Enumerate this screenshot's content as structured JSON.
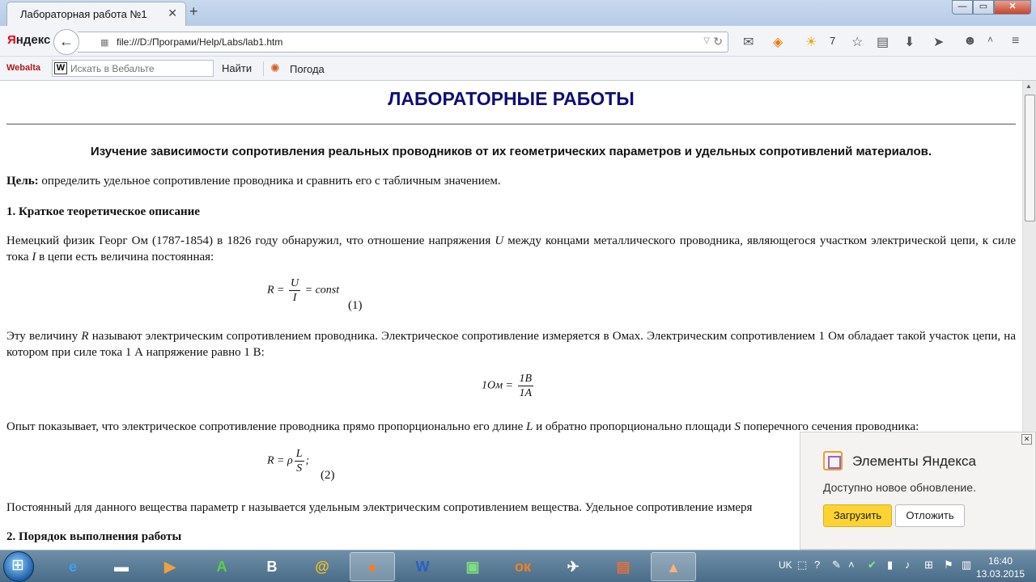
{
  "browser": {
    "tab_title": "Лабораторная работа №1",
    "tab_close": "✕",
    "new_tab": "+",
    "logo": "Яндекс",
    "url": "file:///D:/Програми/Help/Labs/lab1.htm",
    "weather_temp": "7",
    "window_buttons": {
      "minimize": "—",
      "maximize": "▭",
      "close": "✕"
    }
  },
  "bookmarks_bar": {
    "webalta_logo": "Webalta",
    "search_placeholder": "Искать в Вебальте",
    "search_box_letter": "W",
    "find_button": "Найти",
    "weather_link": "Погода"
  },
  "page": {
    "title": "ЛАБОРАТОРНЫЕ РАБОТЫ",
    "subtitle": "Изучение зависимости сопротивления реальных проводников от их геометрических параметров и удельных сопротивлений материалов.",
    "goal_label": "Цель:",
    "goal_text": " определить удельное сопротивление проводника и сравнить его с табличным значением.",
    "section1_heading": "1. Краткое теоретическое описание",
    "para1_a": "Немецкий физик Георг Ом (1787-1854) в 1826 году обнаружил, что отношение напряжения ",
    "para1_u": "U",
    "para1_b": " между концами металлического проводника, являющегося участком электрической цепи, к силе тока ",
    "para1_i": "I",
    "para1_c": " в цепи есть величина постоянная:",
    "formula1": {
      "lhs": "R =",
      "num": "U",
      "den": "I",
      "rhs": "= const",
      "number": "(1)"
    },
    "para2_a": "Эту величину ",
    "para2_r": "R",
    "para2_b": " называют электрическим сопротивлением проводника. Электрическое сопротивление измеряется в Омах. Электрическим сопротивлением 1 Ом обладает такой участок цепи, на котором при силе тока 1 А напряжение равно 1 В:",
    "formula_ohm": {
      "lhs": "1Ом =",
      "num": "1В",
      "den": "1А"
    },
    "para3_a": "Опыт показывает, что электрическое сопротивление проводника прямо пропорционально его длине ",
    "para3_l": "L",
    "para3_b": " и обратно пропорционально площади ",
    "para3_s": "S",
    "para3_c": " поперечного сечения проводника:",
    "formula2": {
      "lhs": "R =",
      "rho": "ρ",
      "num": "L",
      "den": "S",
      "tail": ";",
      "number": "(2)"
    },
    "para4": "Постоянный для данного вещества параметр r называется удельным электрическим сопротивлением вещества. Удельное сопротивление измеря",
    "section2_heading": "2. Порядок выполнения работы"
  },
  "notification": {
    "title": "Элементы Яндекса",
    "text": "Доступно новое обновление.",
    "load_button": "Загрузить",
    "later_button": "Отложить",
    "close": "✕"
  },
  "taskbar": {
    "apps": [
      "start",
      "internet-explorer",
      "film-editor",
      "media-player",
      "green-a-app",
      "vk",
      "mail",
      "firefox",
      "word",
      "task-manager",
      "odnoklassniki",
      "wings-app",
      "powerpoint",
      "pyramid-app"
    ],
    "lang": "UK",
    "clock_time": "16:40",
    "clock_date": "13.03.2015"
  }
}
